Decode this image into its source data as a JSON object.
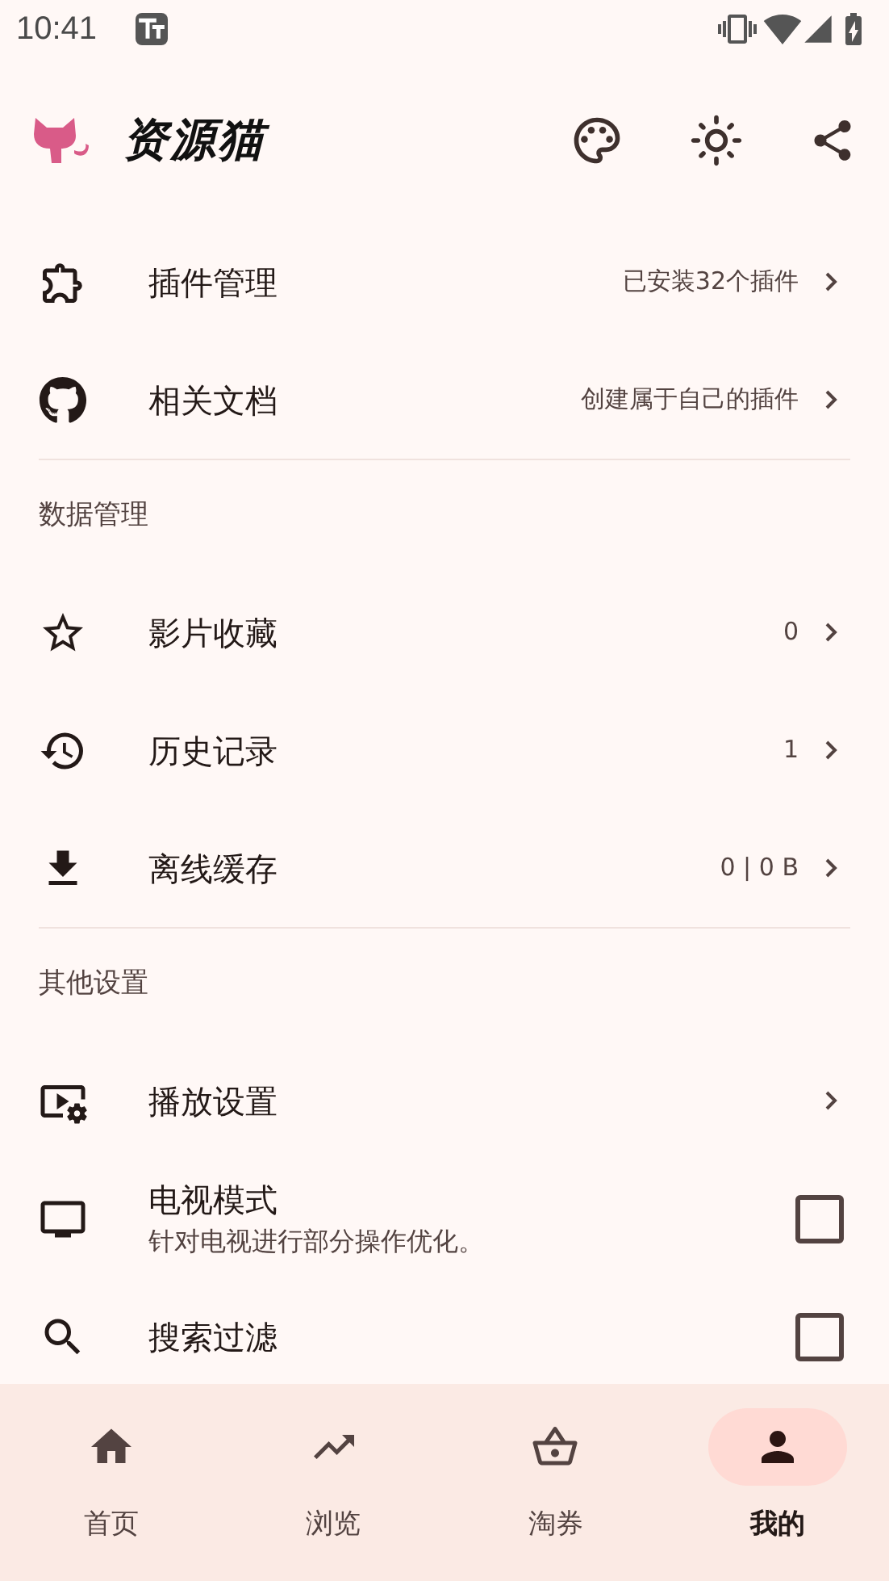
{
  "status_bar": {
    "time": "10:41"
  },
  "app_bar": {
    "title": "资源猫"
  },
  "sections": [
    {
      "items": [
        {
          "kind": "link",
          "label": "插件管理",
          "value": "已安装32个插件"
        },
        {
          "kind": "link",
          "label": "相关文档",
          "value": "创建属于自己的插件"
        }
      ]
    },
    {
      "header": "数据管理",
      "items": [
        {
          "kind": "link",
          "label": "影片收藏",
          "value": "0"
        },
        {
          "kind": "link",
          "label": "历史记录",
          "value": "1"
        },
        {
          "kind": "link",
          "label": "离线缓存",
          "value": "0 | 0 B"
        }
      ]
    },
    {
      "header": "其他设置",
      "items": [
        {
          "kind": "link",
          "label": "播放设置"
        },
        {
          "kind": "checkbox",
          "label": "电视模式",
          "subtitle": "针对电视进行部分操作优化。",
          "checked": false
        },
        {
          "kind": "checkbox",
          "label": "搜索过滤",
          "checked": false
        }
      ]
    }
  ],
  "nav": [
    {
      "label": "首页",
      "selected": false
    },
    {
      "label": "浏览",
      "selected": false
    },
    {
      "label": "淘券",
      "selected": false
    },
    {
      "label": "我的",
      "selected": true
    }
  ]
}
